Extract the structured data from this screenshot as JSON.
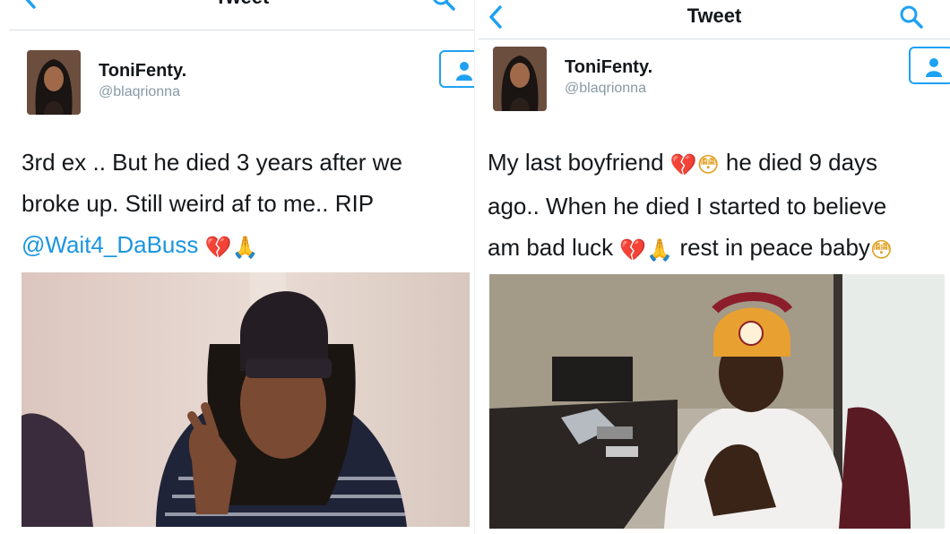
{
  "left_tweet": {
    "nav_title": "Tweet",
    "display_name": "ToniFenty.",
    "handle": "@blaqrionna",
    "line1": "3rd ex .. But he died 3 years after we",
    "line2": "broke up. Still weird af to me.. RIP",
    "mention": "@Wait4_DaBuss",
    "emoji_heart": "💔",
    "emoji_hands": "🙏"
  },
  "right_tweet": {
    "nav_title": "Tweet",
    "display_name": "ToniFenty.",
    "handle": "@blaqrionna",
    "line1_a": "My last boyfriend",
    "line1_b": "he died 9 days",
    "line2": "ago.. When he died I started to believe",
    "line3_a": "am bad luck",
    "line3_b": "rest in peace baby",
    "emoji_heart": "💔",
    "emoji_flushed": "😳",
    "emoji_hands": "🙏"
  },
  "icons": {
    "back": "chevron-left-icon",
    "search": "search-icon",
    "follow": "person-icon",
    "accent_color": "#1da1f2"
  }
}
